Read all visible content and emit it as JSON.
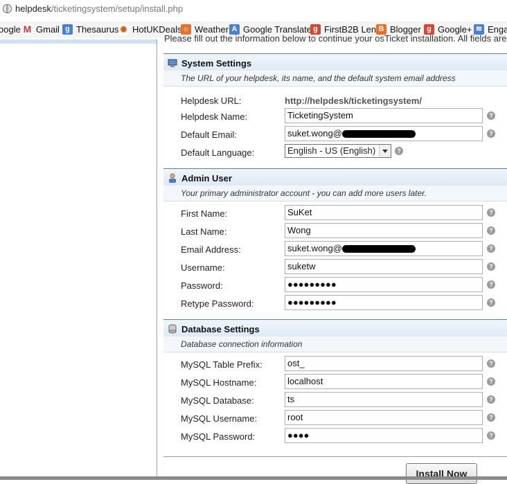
{
  "address_bar": {
    "host": "helpdesk",
    "path": "/ticketingsystem/setup/install.php"
  },
  "bookmarks": [
    {
      "label": "oogle",
      "icon": "none"
    },
    {
      "label": "Gmail",
      "icon": "gmail-icon"
    },
    {
      "label": "Thesaurus",
      "icon": "google-icon"
    },
    {
      "label": "HotUKDeals",
      "icon": "flame-icon"
    },
    {
      "label": "Weather",
      "icon": "weather-icon"
    },
    {
      "label": "Google Translate",
      "icon": "translate-icon"
    },
    {
      "label": "FirstB2B Lens",
      "icon": "gplus-icon"
    },
    {
      "label": "Blogger",
      "icon": "blogger-icon"
    },
    {
      "label": "Google+",
      "icon": "gplus-icon"
    },
    {
      "label": "Enga",
      "icon": "feed-icon"
    }
  ],
  "top_text": "Please fill out the information below to continue your osTicket installation. All fields are",
  "system": {
    "title": "System Settings",
    "subtitle": "The URL of your helpdesk, its name, and the default system email address",
    "url_label": "Helpdesk URL:",
    "url_value": "http://helpdesk/ticketingsystem/",
    "name_label": "Helpdesk Name:",
    "name_value": "TicketingSystem",
    "email_label": "Default Email:",
    "email_value": "suket.wong@",
    "lang_label": "Default Language:",
    "lang_value": "English - US (English)"
  },
  "admin": {
    "title": "Admin User",
    "subtitle": "Your primary administrator account - you can add more users later.",
    "first_label": "First Name:",
    "first_value": "SuKet",
    "last_label": "Last Name:",
    "last_value": "Wong",
    "email_label": "Email Address:",
    "email_value": "suket.wong@",
    "user_label": "Username:",
    "user_value": "suketw",
    "pass_label": "Password:",
    "pass_value": "●●●●●●●●●",
    "repass_label": "Retype Password:",
    "repass_value": "●●●●●●●●●"
  },
  "database": {
    "title": "Database Settings",
    "subtitle": "Database connection information",
    "prefix_label": "MySQL Table Prefix:",
    "prefix_value": "ost_",
    "host_label": "MySQL Hostname:",
    "host_value": "localhost",
    "db_label": "MySQL Database:",
    "db_value": "ts",
    "user_label": "MySQL Username:",
    "user_value": "root",
    "pass_label": "MySQL Password:",
    "pass_value": "●●●●"
  },
  "help_glyph": "?",
  "install_label": "Install Now"
}
